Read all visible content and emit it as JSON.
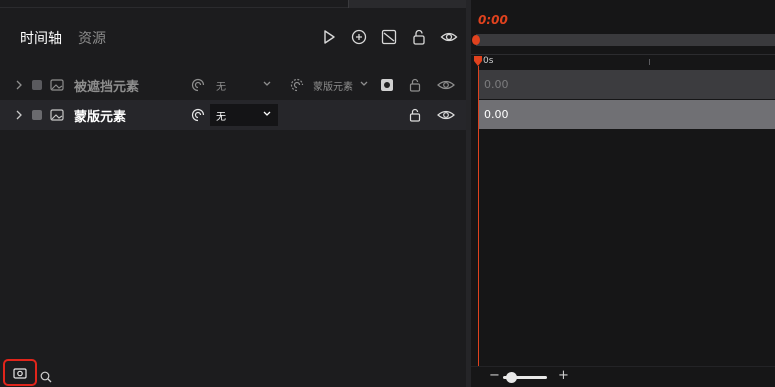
{
  "header": {
    "tabs": [
      {
        "label": "时间轴",
        "active": true
      },
      {
        "label": "资源",
        "active": false
      }
    ],
    "toolbar_icons": [
      "play-icon",
      "add-keyframe-icon",
      "curve-icon",
      "lock-icon",
      "eye-icon"
    ]
  },
  "layers": [
    {
      "name": "被遮挡元素",
      "selected": false,
      "blend_value": "无",
      "mask_value": "蒙版元素",
      "has_mask_swatch": true,
      "time_value": "0.00"
    },
    {
      "name": "蒙版元素",
      "selected": true,
      "blend_value": "无",
      "time_value": "0.00"
    }
  ],
  "timeline": {
    "current_time": "0:00",
    "ruler_start_label": "0s"
  },
  "colors": {
    "accent": "#e0421e",
    "highlight_frame": "#e1251b",
    "background": "#1c1c1e"
  }
}
